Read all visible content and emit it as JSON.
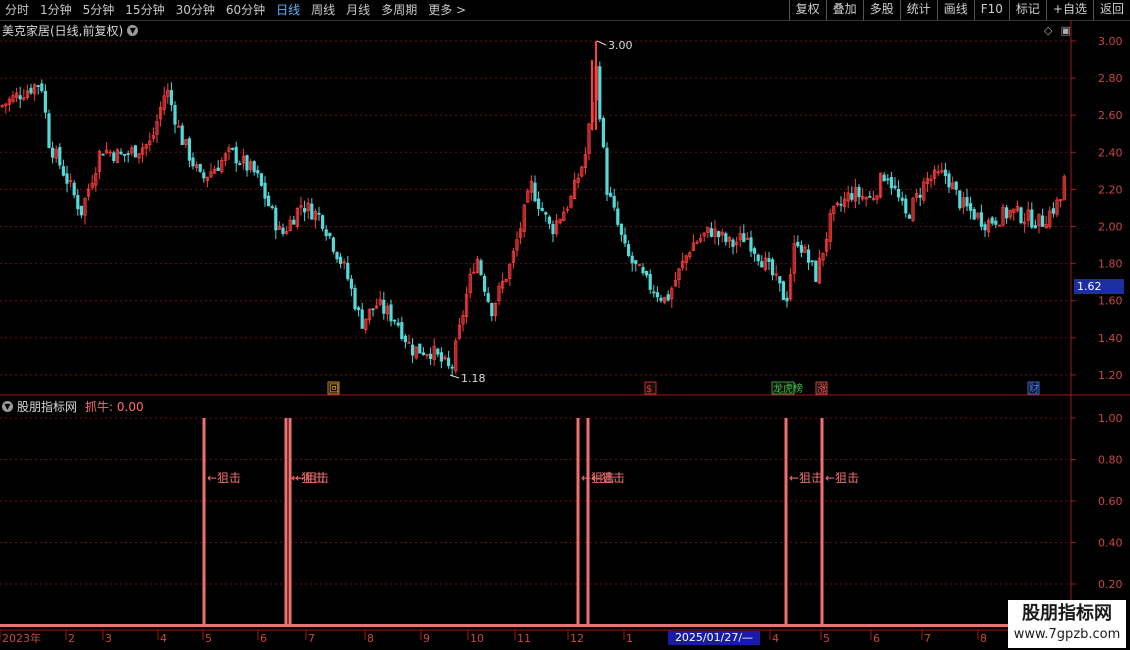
{
  "toolbar": {
    "periods": [
      "分时",
      "1分钟",
      "5分钟",
      "15分钟",
      "30分钟",
      "60分钟",
      "日线",
      "周线",
      "月线",
      "多周期",
      "更多 >"
    ],
    "active_period": "日线",
    "right_buttons": [
      "复权",
      "叠加",
      "多股",
      "统计",
      "画线",
      "F10",
      "标记",
      "+自选",
      "返回"
    ]
  },
  "main": {
    "title": "美克家居(日线,前复权)",
    "y_ticks": [
      "3.00",
      "2.80",
      "2.60",
      "2.40",
      "2.20",
      "2.00",
      "1.80",
      "1.60",
      "1.40",
      "1.20"
    ],
    "high_label": "3.00",
    "low_label": "1.18",
    "current_price": "1.62",
    "event_markers": [
      {
        "text": "回",
        "color": "#f0a030"
      },
      {
        "text": "$",
        "color": "#ff3030"
      },
      {
        "text": "龙虎榜",
        "color": "#40c040"
      },
      {
        "text": "涨",
        "color": "#ff5050"
      },
      {
        "text": "财",
        "color": "#4080ff"
      }
    ]
  },
  "indicator": {
    "title": "股朋指标网",
    "value_label": "抓牛: 0.00",
    "y_ticks": [
      "1.00",
      "0.80",
      "0.60",
      "0.40",
      "0.20"
    ],
    "signal_label": "←狙击",
    "signal_color": "#f07070",
    "signals": [
      {
        "label": "←狙击"
      },
      {
        "label": "←狙击"
      },
      {
        "label": "←狙击"
      },
      {
        "label": "←狙击"
      },
      {
        "label": "←狙击"
      },
      {
        "label": "←狙击"
      },
      {
        "label": "←狙击"
      }
    ]
  },
  "x_axis": {
    "labels": [
      "2023年",
      "2",
      "3",
      "4",
      "5",
      "6",
      "7",
      "8",
      "9",
      "10",
      "11",
      "12",
      "1",
      "2",
      "3",
      "4",
      "5",
      "6",
      "7",
      "8"
    ],
    "cursor_date": "2025/01/27/—"
  },
  "colors": {
    "up": "#ff3c3c",
    "down": "#54d8d8",
    "grid": "#6b1010",
    "axis": "#a01818"
  },
  "watermark": {
    "line1": "股朋指标网",
    "line2": "www.7gpzb.com"
  }
}
